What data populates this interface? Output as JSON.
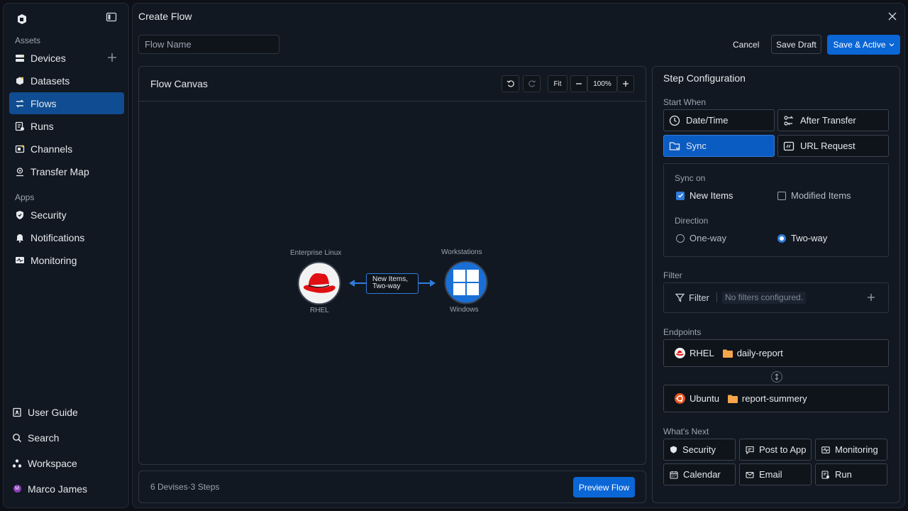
{
  "sidebar": {
    "assets_label": "Assets",
    "apps_label": "Apps",
    "assets": [
      {
        "label": "Devices",
        "icon": "devices-icon"
      },
      {
        "label": "Datasets",
        "icon": "datasets-icon"
      },
      {
        "label": "Flows",
        "icon": "flows-icon",
        "active": true
      },
      {
        "label": "Runs",
        "icon": "runs-icon"
      },
      {
        "label": "Channels",
        "icon": "channels-icon"
      },
      {
        "label": "Transfer Map",
        "icon": "transfer-map-icon"
      }
    ],
    "apps": [
      {
        "label": "Security",
        "icon": "shield-icon"
      },
      {
        "label": "Notifications",
        "icon": "bell-icon"
      },
      {
        "label": "Monitoring",
        "icon": "monitor-icon"
      }
    ],
    "bottom": {
      "user_guide": "User Guide",
      "search": "Search",
      "workspace": "Workspace",
      "user_name": "Marco James",
      "user_initial": "M"
    }
  },
  "header": {
    "title": "Create Flow",
    "flow_name_placeholder": "Flow Name",
    "cancel": "Cancel",
    "save_draft": "Save Draft",
    "save_active": "Save & Active"
  },
  "canvas": {
    "title": "Flow Canvas",
    "fit": "Fit",
    "zoom": "100%",
    "source": {
      "top_label": "Enterprise Linux",
      "bottom_label": "RHEL"
    },
    "target": {
      "top_label": "Workstations",
      "bottom_label": "Windows"
    },
    "edge_label_line1": "New Items,",
    "edge_label_line2": "Two-way"
  },
  "footer": {
    "summary": "6 Devises·3 Steps",
    "preview": "Preview Flow"
  },
  "config": {
    "title": "Step Configuration",
    "start_when": "Start When",
    "triggers": {
      "datetime": "Date/Time",
      "after_transfer": "After Transfer",
      "sync": "Sync",
      "url_request": "URL Request"
    },
    "sync_on": "Sync on",
    "new_items": "New Items",
    "modified_items": "Modified Items",
    "direction": "Direction",
    "one_way": "One-way",
    "two_way": "Two-way",
    "filter_section": "Filter",
    "filter_btn": "Filter",
    "no_filters": "No filters configured.",
    "endpoints": "Endpoints",
    "endpoint1": {
      "device": "RHEL",
      "folder": "daily-report"
    },
    "endpoint2": {
      "device": "Ubuntu",
      "folder": "report-summery"
    },
    "whats_next": "What's Next",
    "next": {
      "security": "Security",
      "post_to_app": "Post to App",
      "monitoring": "Monitoring",
      "calendar": "Calendar",
      "email": "Email",
      "run": "Run"
    }
  },
  "colors": {
    "accent": "#0b66d6",
    "active_nav": "#0f4c91",
    "rhel_red": "#e10e12",
    "windows_blue": "#1a6fd6",
    "ubuntu_orange": "#e95420",
    "folder": "#f5a54a"
  }
}
